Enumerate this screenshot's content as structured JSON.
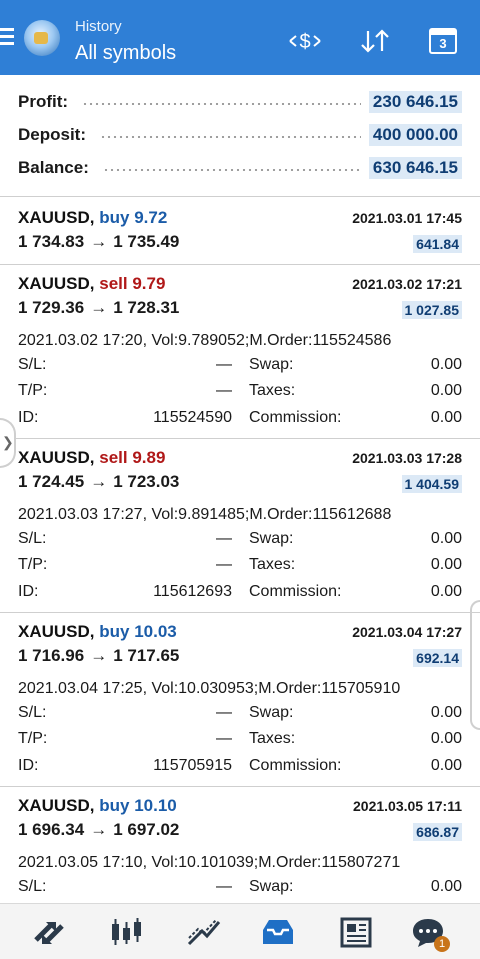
{
  "header": {
    "subtitle": "History",
    "title": "All symbols",
    "calendar_day": "3",
    "bg_color": "#2f7fd6"
  },
  "summary": {
    "profit_label": "Profit:",
    "profit_value": "230 646.15",
    "deposit_label": "Deposit:",
    "deposit_value": "400 000.00",
    "balance_label": "Balance:",
    "balance_value": "630 646.15"
  },
  "labels": {
    "sl": "S/L:",
    "tp": "T/P:",
    "id": "ID:",
    "swap": "Swap:",
    "taxes": "Taxes:",
    "commission": "Commission:",
    "arrow": "→"
  },
  "deals": [
    {
      "symbol": "XAUUSD,",
      "action": "buy 9.72",
      "side": "buy",
      "time": "2021.03.01 17:45",
      "open_price": "1 734.83",
      "close_price": "1 735.49",
      "profit": "641.84"
    },
    {
      "symbol": "XAUUSD,",
      "action": "sell 9.79",
      "side": "sell",
      "time": "2021.03.02 17:21",
      "open_price": "1 729.36",
      "close_price": "1 728.31",
      "profit": "1 027.85",
      "detail": "2021.03.02 17:20, Vol:9.789052;M.Order:115524586",
      "sl": "—",
      "tp": "—",
      "id": "115524590",
      "swap": "0.00",
      "taxes": "0.00",
      "commission": "0.00"
    },
    {
      "symbol": "XAUUSD,",
      "action": "sell 9.89",
      "side": "sell",
      "time": "2021.03.03 17:28",
      "open_price": "1 724.45",
      "close_price": "1 723.03",
      "profit": "1 404.59",
      "detail": "2021.03.03 17:27, Vol:9.891485;M.Order:115612688",
      "sl": "—",
      "tp": "—",
      "id": "115612693",
      "swap": "0.00",
      "taxes": "0.00",
      "commission": "0.00"
    },
    {
      "symbol": "XAUUSD,",
      "action": "buy 10.03",
      "side": "buy",
      "time": "2021.03.04 17:27",
      "open_price": "1 716.96",
      "close_price": "1 717.65",
      "profit": "692.14",
      "detail": "2021.03.04 17:25, Vol:10.030953;M.Order:115705910",
      "sl": "—",
      "tp": "—",
      "id": "115705915",
      "swap": "0.00",
      "taxes": "0.00",
      "commission": "0.00"
    },
    {
      "symbol": "XAUUSD,",
      "action": "buy 10.10",
      "side": "buy",
      "time": "2021.03.05 17:11",
      "open_price": "1 696.34",
      "close_price": "1 697.02",
      "profit": "686.87",
      "detail": "2021.03.05 17:10, Vol:10.101039;M.Order:115807271",
      "sl": "—",
      "swap": "0.00"
    }
  ],
  "bottom_nav": {
    "chat_badge": "1"
  }
}
